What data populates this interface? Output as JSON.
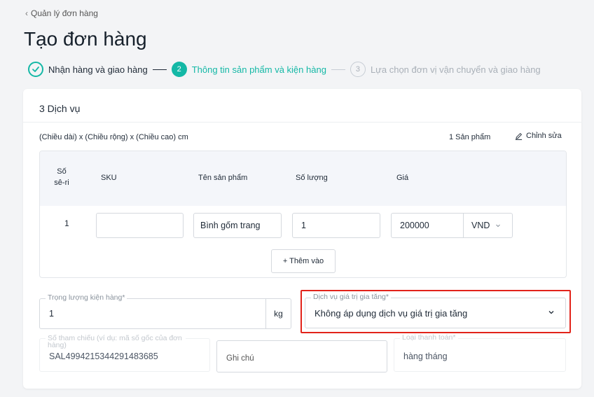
{
  "breadcrumb": {
    "label": "Quản lý đơn hàng"
  },
  "page_title": "Tạo đơn hàng",
  "stepper": {
    "step1": {
      "label": "Nhận hàng và giao hàng"
    },
    "step2": {
      "number": "2",
      "label": "Thông tin sản phẩm và kiện hàng"
    },
    "step3": {
      "number": "3",
      "label": "Lựa chọn đơn vị vận chuyển và giao hàng"
    }
  },
  "card": {
    "title": "3 Dịch vụ",
    "dimensions": "(Chiều dài) x (Chiều rộng) x (Chiều cao) cm",
    "products_count": "1 Sản phẩm",
    "edit_label": "Chỉnh sửa"
  },
  "table": {
    "headers": {
      "serial": "Số sê-ri",
      "sku": "SKU",
      "name": "Tên sản phẩm",
      "qty": "Số lượng",
      "price": "Giá"
    },
    "row": {
      "serial": "1",
      "sku": "",
      "name": "Bình gốm trang",
      "qty": "1",
      "price": "200000",
      "currency": "VND"
    },
    "add_label": "+ Thêm vào"
  },
  "form": {
    "weight": {
      "label": "Trọng lượng kiện hàng",
      "value": "1",
      "unit": "kg"
    },
    "service": {
      "label": "Dịch vụ giá trị gia tăng",
      "value": "Không áp dụng dịch vụ giá trị gia tăng"
    },
    "reference": {
      "label": "Số tham chiếu (ví dụ: mã số gốc của đơn hàng)",
      "value": "SAL4994215344291483685"
    },
    "note": {
      "placeholder": "Ghi chú"
    },
    "payment": {
      "label": "Loại thanh toán",
      "value": "hàng tháng"
    }
  },
  "colors": {
    "accent": "#14b8a6",
    "highlight": "#e2231a"
  }
}
